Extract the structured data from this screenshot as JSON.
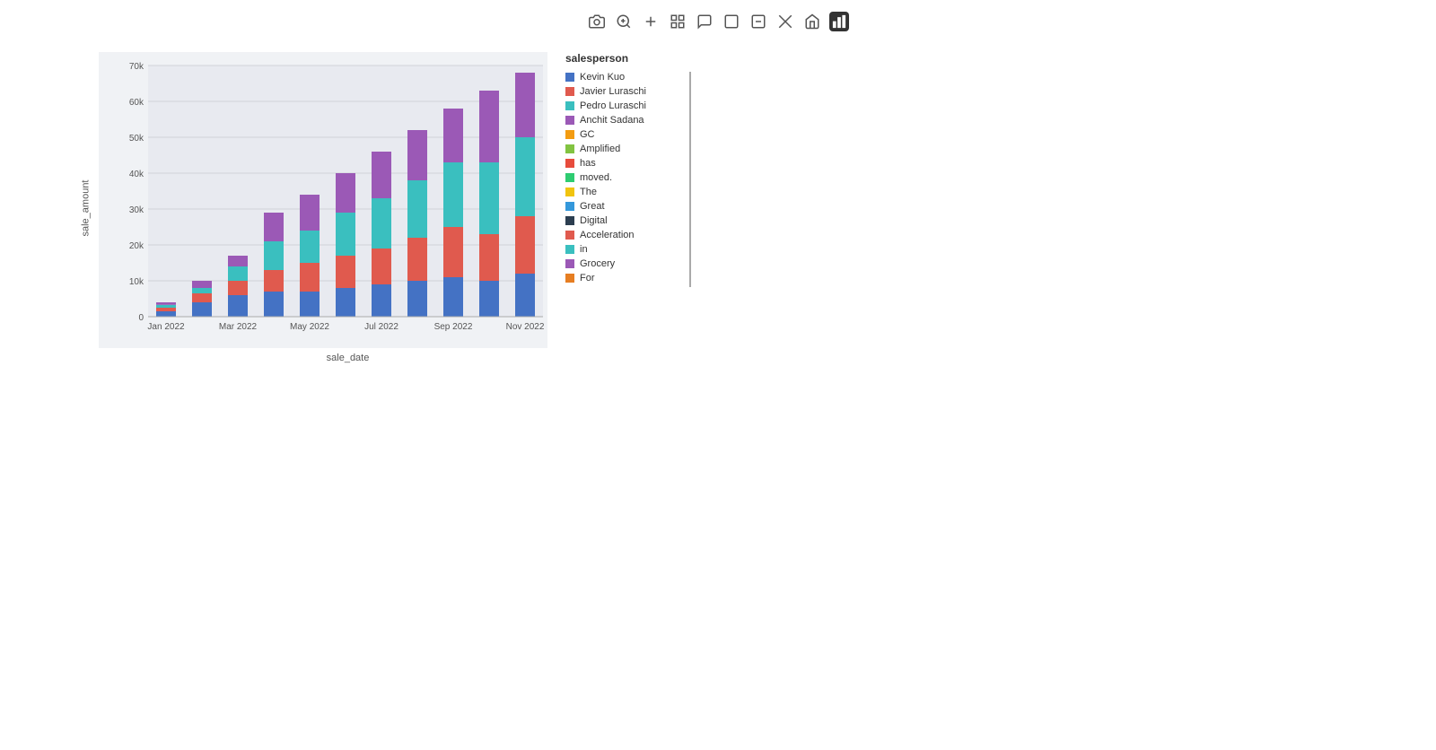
{
  "toolbar": {
    "icons": [
      {
        "name": "camera-icon",
        "symbol": "📷",
        "active": false
      },
      {
        "name": "zoom-icon",
        "symbol": "🔍",
        "active": false
      },
      {
        "name": "plus-icon",
        "symbol": "+",
        "active": false
      },
      {
        "name": "grid-icon",
        "symbol": "⊞",
        "active": false
      },
      {
        "name": "comment-icon",
        "symbol": "💬",
        "active": false
      },
      {
        "name": "square-icon",
        "symbol": "⬜",
        "active": false
      },
      {
        "name": "minus-square-icon",
        "symbol": "⊟",
        "active": false
      },
      {
        "name": "crosshair-icon",
        "symbol": "⊠",
        "active": false
      },
      {
        "name": "home-icon",
        "symbol": "⌂",
        "active": false
      },
      {
        "name": "chart-icon",
        "symbol": "📊",
        "active": true
      }
    ]
  },
  "chart": {
    "y_axis_label": "sale_amount",
    "x_axis_label": "sale_date",
    "y_ticks": [
      "0",
      "10k",
      "20k",
      "30k",
      "40k",
      "50k",
      "60k",
      "70k"
    ],
    "x_ticks": [
      "Jan 2022",
      "Mar 2022",
      "May 2022",
      "Jul 2022",
      "Sep 2022",
      "Nov 2022"
    ],
    "legend_title": "salesperson",
    "legend_items": [
      {
        "label": "Kevin Kuo",
        "color": "#4472C4"
      },
      {
        "label": "Javier Luraschi",
        "color": "#E05A4E"
      },
      {
        "label": "Pedro Luraschi",
        "color": "#3ABFBF"
      },
      {
        "label": "Anchit Sadana",
        "color": "#9B59B6"
      },
      {
        "label": "GC",
        "color": "#F39C12"
      },
      {
        "label": "Amplified",
        "color": "#82C341"
      },
      {
        "label": "has",
        "color": "#E74C3C"
      },
      {
        "label": "moved.",
        "color": "#2ECC71"
      },
      {
        "label": "The",
        "color": "#F1C40F"
      },
      {
        "label": "Great",
        "color": "#3498DB"
      },
      {
        "label": "Digital",
        "color": "#2C3E50"
      },
      {
        "label": "Acceleration",
        "color": "#E05A4E"
      },
      {
        "label": "in",
        "color": "#3ABFBF"
      },
      {
        "label": "Grocery",
        "color": "#9B59B6"
      },
      {
        "label": "For",
        "color": "#E67E22"
      }
    ],
    "bars": [
      {
        "month": "Jan 2022",
        "segments": [
          {
            "color": "#4472C4",
            "value": 1500
          },
          {
            "color": "#E05A4E",
            "value": 1000
          },
          {
            "color": "#3ABFBF",
            "value": 800
          },
          {
            "color": "#9B59B6",
            "value": 700
          }
        ],
        "total": 4000
      },
      {
        "month": "Feb 2022",
        "segments": [
          {
            "color": "#4472C4",
            "value": 4000
          },
          {
            "color": "#E05A4E",
            "value": 2500
          },
          {
            "color": "#3ABFBF",
            "value": 1500
          },
          {
            "color": "#9B59B6",
            "value": 2000
          }
        ],
        "total": 10000
      },
      {
        "month": "Mar 2022",
        "segments": [
          {
            "color": "#4472C4",
            "value": 6000
          },
          {
            "color": "#E05A4E",
            "value": 4000
          },
          {
            "color": "#3ABFBF",
            "value": 4000
          },
          {
            "color": "#9B59B6",
            "value": 3000
          }
        ],
        "total": 17000
      },
      {
        "month": "Apr 2022",
        "segments": [
          {
            "color": "#4472C4",
            "value": 7000
          },
          {
            "color": "#E05A4E",
            "value": 6000
          },
          {
            "color": "#3ABFBF",
            "value": 8000
          },
          {
            "color": "#9B59B6",
            "value": 8000
          }
        ],
        "total": 29000
      },
      {
        "month": "May 2022",
        "segments": [
          {
            "color": "#4472C4",
            "value": 7000
          },
          {
            "color": "#E05A4E",
            "value": 8000
          },
          {
            "color": "#3ABFBF",
            "value": 9000
          },
          {
            "color": "#9B59B6",
            "value": 10000
          }
        ],
        "total": 34000
      },
      {
        "month": "Jun 2022",
        "segments": [
          {
            "color": "#4472C4",
            "value": 8000
          },
          {
            "color": "#E05A4E",
            "value": 9000
          },
          {
            "color": "#3ABFBF",
            "value": 12000
          },
          {
            "color": "#9B59B6",
            "value": 11000
          }
        ],
        "total": 40000
      },
      {
        "month": "Jul 2022",
        "segments": [
          {
            "color": "#4472C4",
            "value": 9000
          },
          {
            "color": "#E05A4E",
            "value": 10000
          },
          {
            "color": "#3ABFBF",
            "value": 14000
          },
          {
            "color": "#9B59B6",
            "value": 13000
          }
        ],
        "total": 46000
      },
      {
        "month": "Aug 2022",
        "segments": [
          {
            "color": "#4472C4",
            "value": 10000
          },
          {
            "color": "#E05A4E",
            "value": 12000
          },
          {
            "color": "#3ABFBF",
            "value": 16000
          },
          {
            "color": "#9B59B6",
            "value": 14000
          }
        ],
        "total": 52000
      },
      {
        "month": "Sep 2022",
        "segments": [
          {
            "color": "#4472C4",
            "value": 11000
          },
          {
            "color": "#E05A4E",
            "value": 14000
          },
          {
            "color": "#3ABFBF",
            "value": 18000
          },
          {
            "color": "#9B59B6",
            "value": 15000
          }
        ],
        "total": 58000
      },
      {
        "month": "Oct 2022",
        "segments": [
          {
            "color": "#4472C4",
            "value": 10000
          },
          {
            "color": "#E05A4E",
            "value": 13000
          },
          {
            "color": "#3ABFBF",
            "value": 20000
          },
          {
            "color": "#9B59B6",
            "value": 20000
          }
        ],
        "total": 63000
      },
      {
        "month": "Nov 2022",
        "segments": [
          {
            "color": "#4472C4",
            "value": 12000
          },
          {
            "color": "#E05A4E",
            "value": 16000
          },
          {
            "color": "#3ABFBF",
            "value": 22000
          },
          {
            "color": "#9B59B6",
            "value": 18000
          }
        ],
        "total": 68000
      }
    ]
  }
}
